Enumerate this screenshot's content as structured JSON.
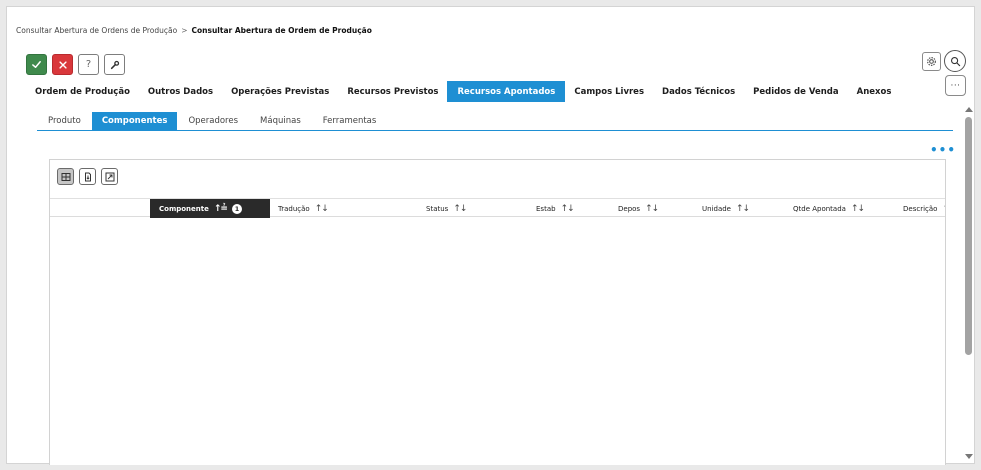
{
  "breadcrumb": {
    "parent": "Consultar Abertura de Ordens de Produção",
    "separator": ">",
    "current": "Consultar Abertura de Ordem de Produção"
  },
  "toolbar": {
    "confirm_icon": "check-icon",
    "cancel_icon": "close-icon",
    "help_label": "?",
    "tools_icon": "wrench-icon"
  },
  "header_tools": {
    "settings_icon": "gear-icon",
    "search_icon": "search-icon",
    "more_label": "···"
  },
  "main_tabs": [
    {
      "label": "Ordem de Produção",
      "active": false
    },
    {
      "label": "Outros Dados",
      "active": false
    },
    {
      "label": "Operações Previstas",
      "active": false
    },
    {
      "label": "Recursos Previstos",
      "active": false
    },
    {
      "label": "Recursos Apontados",
      "active": true
    },
    {
      "label": "Campos Livres",
      "active": false
    },
    {
      "label": "Dados Técnicos",
      "active": false
    },
    {
      "label": "Pedidos de Venda",
      "active": false
    },
    {
      "label": "Anexos",
      "active": false
    }
  ],
  "sub_tabs": [
    {
      "label": "Produto",
      "active": false
    },
    {
      "label": "Componentes",
      "active": true
    },
    {
      "label": "Operadores",
      "active": false
    },
    {
      "label": "Máquinas",
      "active": false
    },
    {
      "label": "Ferramentas",
      "active": false
    }
  ],
  "grid": {
    "menu_label": "•••",
    "tools": [
      "grid-view-icon",
      "export-file-icon",
      "expand-icon"
    ],
    "sort_symbol": "↑↓",
    "sorted_symbol": "↑≟",
    "sort_badge": "1",
    "columns": [
      {
        "label": "Componente",
        "sorted": true
      },
      {
        "label": "Tradução",
        "sorted": false
      },
      {
        "label": "Status",
        "sorted": false
      },
      {
        "label": "Estab",
        "sorted": false
      },
      {
        "label": "Depos",
        "sorted": false
      },
      {
        "label": "Unidade",
        "sorted": false
      },
      {
        "label": "Qtde Apontada",
        "sorted": false
      },
      {
        "label": "Descrição",
        "sorted": false
      }
    ],
    "rows": []
  },
  "colors": {
    "accent": "#1e8fd3",
    "confirm": "#3f8a4c",
    "cancel": "#d9373b",
    "sorted_header": "#2a2a2a"
  }
}
